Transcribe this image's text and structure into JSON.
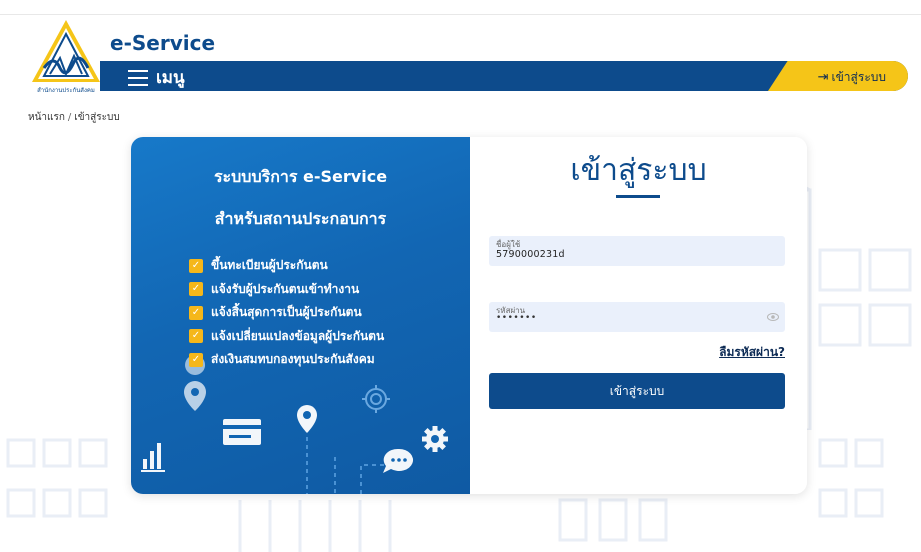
{
  "header": {
    "brand": "e-Service",
    "logo_caption": "สำนักงานประกันสังคม",
    "menu_label": "เมนู",
    "login_link": "เข้าสู่ระบบ"
  },
  "breadcrumb": {
    "home": "หน้าแรก",
    "separator": "/",
    "current": "เข้าสู่ระบบ"
  },
  "info_panel": {
    "title_line1": "ระบบบริการ e-Service",
    "title_line2": "สำหรับสถานประกอบการ",
    "features": [
      "ขึ้นทะเบียนผู้ประกันตน",
      "แจ้งรับผู้ประกันตนเข้าทำงาน",
      "แจ้งสิ้นสุดการเป็นผู้ประกันตน",
      "แจ้งเปลี่ยนแปลงข้อมูลผู้ประกันตน",
      "ส่งเงินสมทบกองทุนประกันสังคม"
    ]
  },
  "login_form": {
    "title": "เข้าสู่ระบบ",
    "username_label": "ชื่อผู้ใช้",
    "username_value": "5790000231d",
    "password_label": "รหัสผ่าน",
    "password_value": "•••••••",
    "forgot_password": "ลืมรหัสผ่าน?",
    "submit_label": "เข้าสู่ระบบ"
  },
  "colors": {
    "primary": "#0d4b8c",
    "accent": "#f5c518",
    "panel_blue": "#1266b3",
    "field_bg": "#eaf0fb"
  },
  "icons": [
    "logo-emblem",
    "hamburger-icon",
    "login-arrow-icon",
    "checkbox-icon",
    "eye-icon",
    "map-pin-icon",
    "card-icon",
    "chat-icon",
    "gear-icon",
    "bar-chart-icon",
    "target-icon"
  ]
}
